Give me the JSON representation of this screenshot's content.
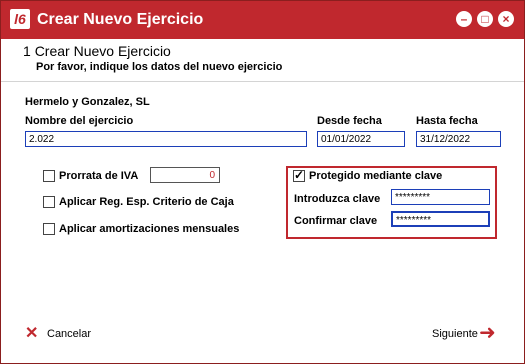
{
  "window": {
    "title": "Crear Nuevo Ejercicio",
    "app_icon": "l6",
    "buttons": [
      "minimize-icon",
      "maximize-icon",
      "close-icon"
    ]
  },
  "step": {
    "number": "1",
    "title": "Crear Nuevo Ejercicio",
    "subtitle": "Por favor, indique los datos del nuevo ejercicio"
  },
  "company": "Hermelo y Gonzalez, SL",
  "fields": {
    "nombre_label": "Nombre del ejercicio",
    "nombre_value": "2.022",
    "desde_label": "Desde fecha",
    "desde_value": "01/01/2022",
    "hasta_label": "Hasta fecha",
    "hasta_value": "31/12/2022"
  },
  "options": {
    "prorrata_label": "Prorrata de IVA",
    "prorrata_value": "0",
    "criterio_caja_label": "Aplicar Reg. Esp. Criterio de Caja",
    "amortizaciones_label": "Aplicar amortizaciones mensuales"
  },
  "password": {
    "protect_label": "Protegido mediante clave",
    "protect_checked": true,
    "enter_label": "Introduzca clave",
    "enter_value": "*********",
    "confirm_label": "Confirmar clave",
    "confirm_value": "*********"
  },
  "footer": {
    "cancel_label": "Cancelar",
    "next_label": "Siguiente"
  },
  "colors": {
    "brand": "#c0282e",
    "input_border": "#1c3fb8"
  }
}
